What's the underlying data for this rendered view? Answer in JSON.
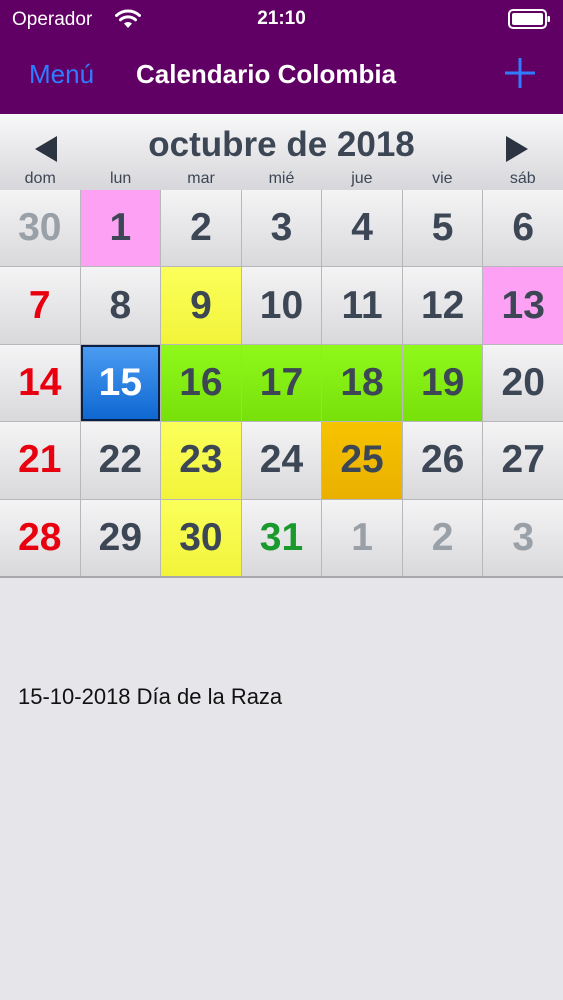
{
  "status": {
    "carrier": "Operador",
    "time": "21:10"
  },
  "nav": {
    "menu_label": "Menú",
    "title": "Calendario Colombia"
  },
  "calendar": {
    "month_title": "octubre de 2018",
    "weekdays": [
      "dom",
      "lun",
      "mar",
      "mié",
      "jue",
      "vie",
      "sáb"
    ],
    "days": [
      {
        "label": "30",
        "style": "other"
      },
      {
        "label": "1",
        "style": "pink"
      },
      {
        "label": "2",
        "style": ""
      },
      {
        "label": "3",
        "style": ""
      },
      {
        "label": "4",
        "style": ""
      },
      {
        "label": "5",
        "style": ""
      },
      {
        "label": "6",
        "style": ""
      },
      {
        "label": "7",
        "style": "sunday"
      },
      {
        "label": "8",
        "style": ""
      },
      {
        "label": "9",
        "style": "yellow"
      },
      {
        "label": "10",
        "style": ""
      },
      {
        "label": "11",
        "style": ""
      },
      {
        "label": "12",
        "style": ""
      },
      {
        "label": "13",
        "style": "pink"
      },
      {
        "label": "14",
        "style": "sunday"
      },
      {
        "label": "15",
        "style": "selected"
      },
      {
        "label": "16",
        "style": "green"
      },
      {
        "label": "17",
        "style": "green"
      },
      {
        "label": "18",
        "style": "green"
      },
      {
        "label": "19",
        "style": "green"
      },
      {
        "label": "20",
        "style": ""
      },
      {
        "label": "21",
        "style": "sunday"
      },
      {
        "label": "22",
        "style": ""
      },
      {
        "label": "23",
        "style": "yellow"
      },
      {
        "label": "24",
        "style": ""
      },
      {
        "label": "25",
        "style": "orange"
      },
      {
        "label": "26",
        "style": ""
      },
      {
        "label": "27",
        "style": ""
      },
      {
        "label": "28",
        "style": "sunday"
      },
      {
        "label": "29",
        "style": ""
      },
      {
        "label": "30",
        "style": "yellow"
      },
      {
        "label": "31",
        "style": "green-text"
      },
      {
        "label": "1",
        "style": "other"
      },
      {
        "label": "2",
        "style": "other"
      },
      {
        "label": "3",
        "style": "other"
      }
    ]
  },
  "events": [
    {
      "text": "15-10-2018 Día de la Raza"
    }
  ],
  "colors": {
    "nav_background": "#610064",
    "accent": "#2f7cff",
    "holiday_red": "#e8000f",
    "selected_blue": "#0d66d0"
  },
  "icons": {
    "wifi": "wifi-icon",
    "battery": "battery-icon",
    "add": "plus-icon",
    "prev": "triangle-left-icon",
    "next": "triangle-right-icon"
  }
}
